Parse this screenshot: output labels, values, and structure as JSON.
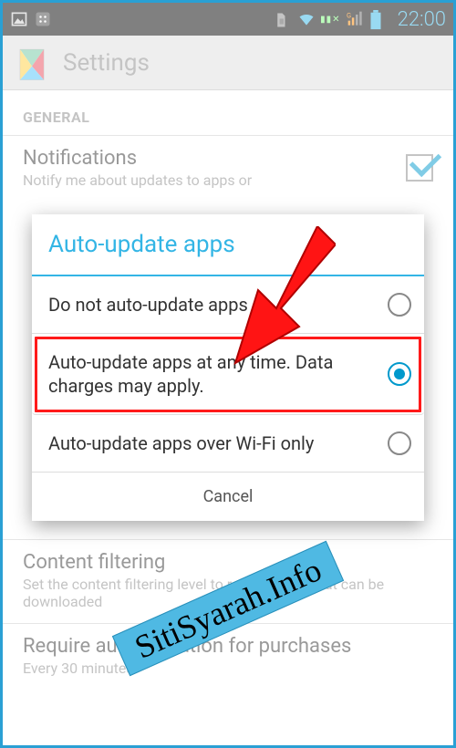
{
  "status": {
    "time": "22:00"
  },
  "actionbar": {
    "title": "Settings"
  },
  "settings": {
    "section_general": "GENERAL",
    "notifications": {
      "title": "Notifications",
      "sub": "Notify me about updates to apps or",
      "checked": true
    },
    "content_filtering": {
      "title": "Content filtering",
      "sub": "Set the content filtering level to restrict apps that can be downloaded"
    },
    "require_auth": {
      "title": "Require authentication for purchases",
      "sub": "Every 30 minutes"
    }
  },
  "dialog": {
    "title": "Auto-update apps",
    "options": [
      {
        "label": "Do not auto-update apps",
        "selected": false
      },
      {
        "label": "Auto-update apps at any time. Data charges may apply.",
        "selected": true
      },
      {
        "label": "Auto-update apps over Wi-Fi only",
        "selected": false
      }
    ],
    "cancel": "Cancel"
  },
  "watermark": "SitiSyarah.Info"
}
